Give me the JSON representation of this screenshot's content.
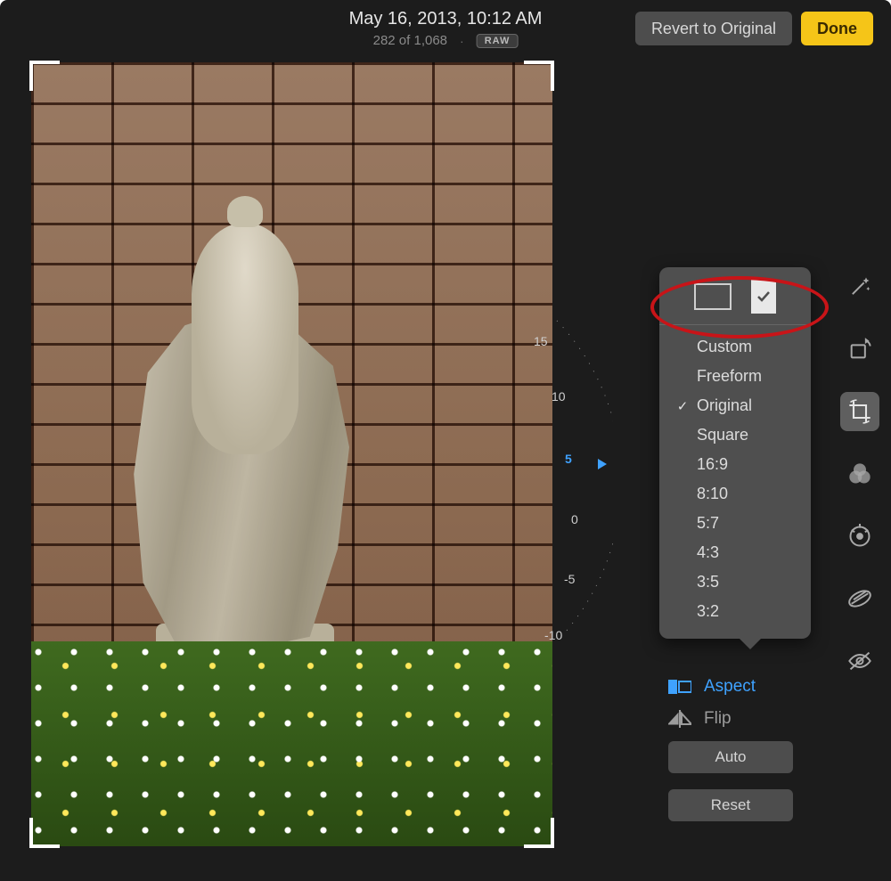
{
  "header": {
    "date": "May 16, 2013, 10:12 AM",
    "counter": "282 of 1,068",
    "format_badge": "RAW",
    "revert_label": "Revert to Original",
    "done_label": "Done"
  },
  "dial": {
    "current": 5,
    "ticks": [
      15,
      10,
      5,
      0,
      -5,
      -10
    ]
  },
  "tools": [
    {
      "id": "enhance",
      "name": "magic-wand-icon",
      "selected": false
    },
    {
      "id": "rotate",
      "name": "rotate-icon",
      "selected": false
    },
    {
      "id": "crop",
      "name": "crop-icon",
      "selected": true
    },
    {
      "id": "filters",
      "name": "filters-icon",
      "selected": false
    },
    {
      "id": "adjust",
      "name": "adjust-icon",
      "selected": false
    },
    {
      "id": "retouch",
      "name": "retouch-icon",
      "selected": false
    },
    {
      "id": "redeye",
      "name": "redeye-icon",
      "selected": false
    }
  ],
  "crop_panel": {
    "aspect_label": "Aspect",
    "flip_label": "Flip",
    "auto_label": "Auto",
    "reset_label": "Reset"
  },
  "aspect_popover": {
    "orientation": "portrait",
    "items": [
      {
        "label": "Custom",
        "selected": false
      },
      {
        "label": "Freeform",
        "selected": false
      },
      {
        "label": "Original",
        "selected": true
      },
      {
        "label": "Square",
        "selected": false
      },
      {
        "label": "16:9",
        "selected": false
      },
      {
        "label": "8:10",
        "selected": false
      },
      {
        "label": "5:7",
        "selected": false
      },
      {
        "label": "4:3",
        "selected": false
      },
      {
        "label": "3:5",
        "selected": false
      },
      {
        "label": "3:2",
        "selected": false
      }
    ]
  }
}
